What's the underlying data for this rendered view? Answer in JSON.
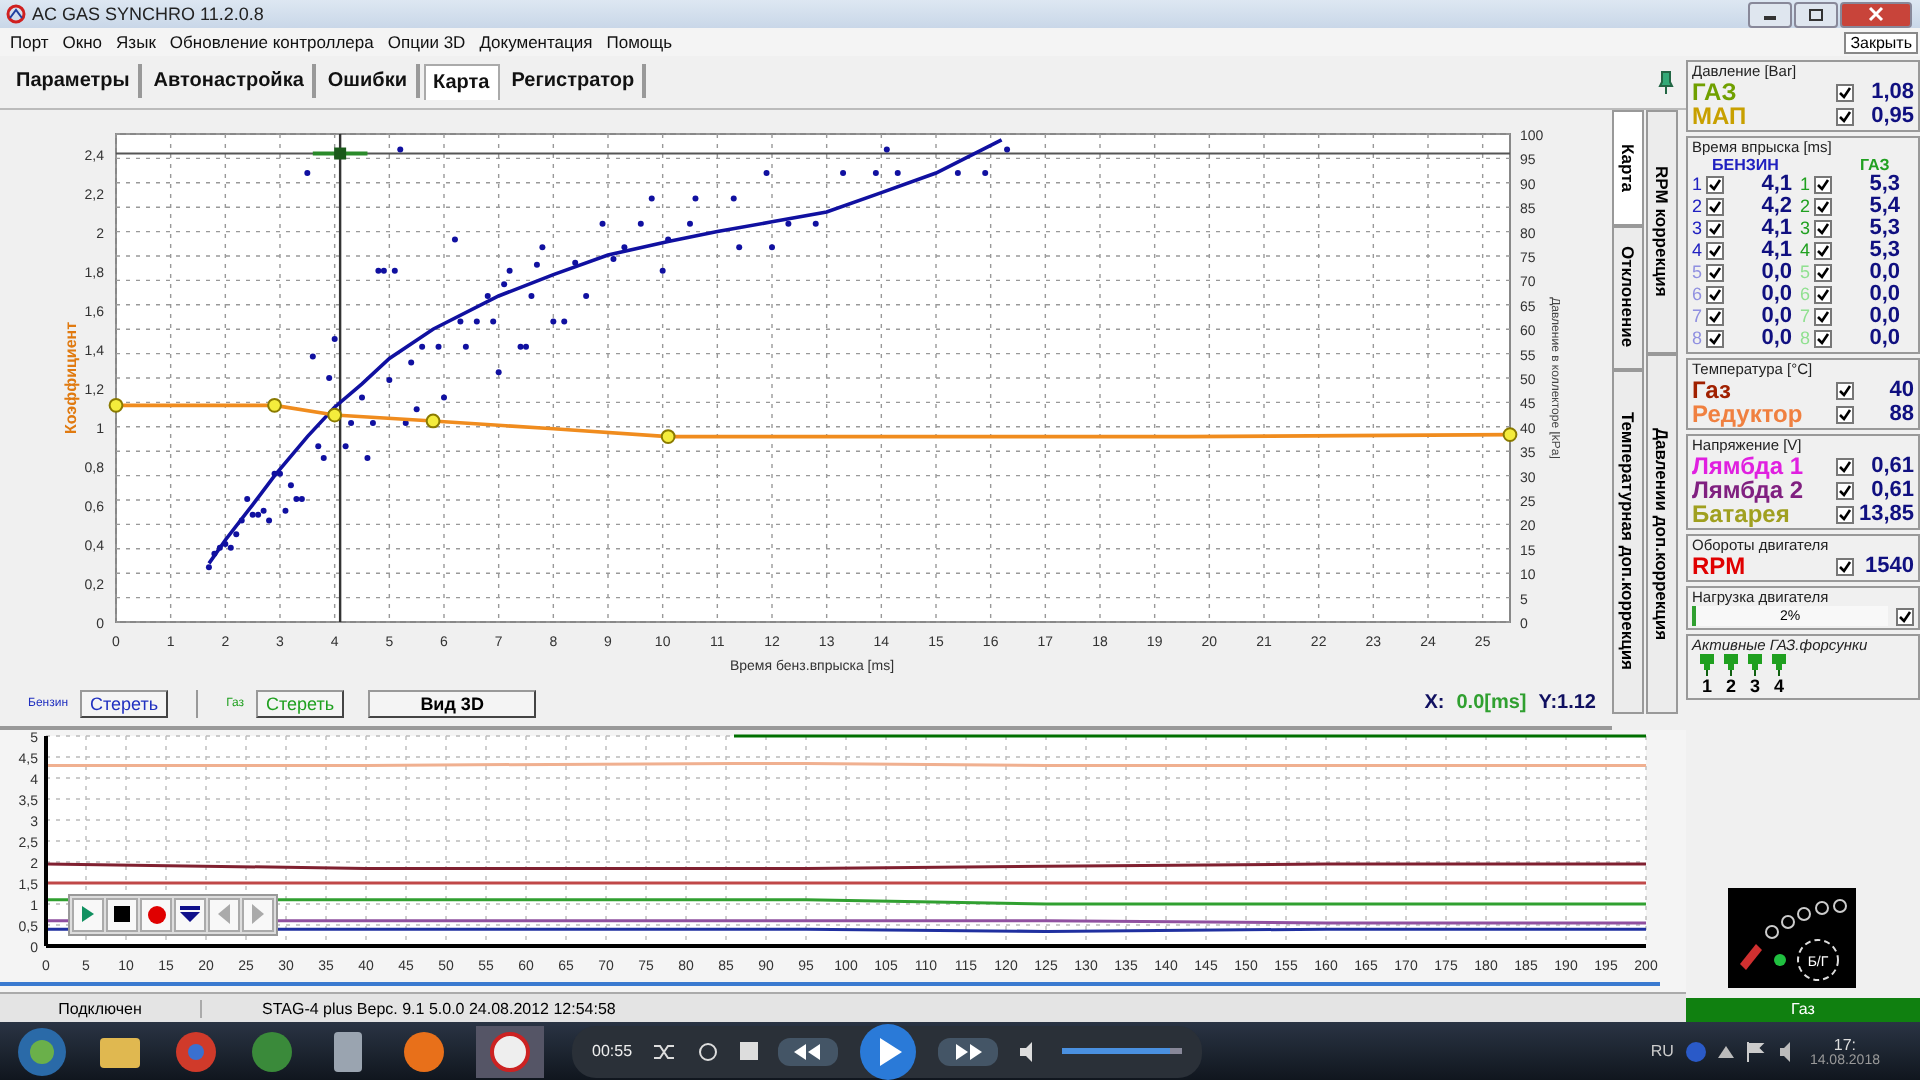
{
  "window": {
    "title": "AC GAS SYNCHRO  11.2.0.8"
  },
  "menu": [
    "Порт",
    "Окно",
    "Язык",
    "Обновление контроллера",
    "Опции 3D",
    "Документация",
    "Помощь"
  ],
  "tooltip": "Закрыть",
  "tabs": [
    {
      "label": "Параметры",
      "selected": false
    },
    {
      "label": "Автонастройка",
      "selected": false
    },
    {
      "label": "Ошибки",
      "selected": false
    },
    {
      "label": "Карта",
      "selected": true
    },
    {
      "label": "Регистратор",
      "selected": false
    }
  ],
  "map_chart": {
    "chart_data": {
      "type": "scatter",
      "xlabel": "Время бенз.впрыска [ms]",
      "ylabel": "Коэффициент",
      "xlim": [
        0,
        25.5
      ],
      "ylim": [
        0,
        2.5
      ],
      "grid": true,
      "xticks": [
        0,
        1,
        2,
        3,
        4,
        5,
        6,
        7,
        8,
        9,
        10,
        11,
        12,
        13,
        14,
        15,
        16,
        17,
        18,
        19,
        20,
        21,
        22,
        23,
        24,
        25
      ],
      "yticks": [
        {
          "value": 0,
          "label": "0"
        },
        {
          "value": 0.2,
          "label": "0,2"
        },
        {
          "value": 0.4,
          "label": "0,4"
        },
        {
          "value": 0.6,
          "label": "0,6"
        },
        {
          "value": 0.8,
          "label": "0,8"
        },
        {
          "value": 1,
          "label": "1"
        },
        {
          "value": 1.2,
          "label": "1,2"
        },
        {
          "value": 1.4,
          "label": "1,4"
        },
        {
          "value": 1.6,
          "label": "1,6"
        },
        {
          "value": 1.8,
          "label": "1,8"
        },
        {
          "value": 2,
          "label": "2"
        },
        {
          "value": 2.2,
          "label": "2,2"
        },
        {
          "value": 2.4,
          "label": "2,4"
        }
      ],
      "series": [
        {
          "type": "scatter",
          "color": "#1010a0",
          "x": [
            1.7,
            1.8,
            1.9,
            2,
            2.1,
            2.2,
            2.3,
            2.4,
            2.5,
            2.6,
            2.7,
            2.8,
            2.9,
            3,
            3.1,
            3.2,
            3.3,
            3.4,
            3.5,
            3.6,
            3.7,
            3.8,
            3.9,
            4,
            4.2,
            4.3,
            4.5,
            4.6,
            4.7,
            4.8,
            4.9,
            5,
            5.1,
            5.2,
            5.3,
            5.4,
            5.5,
            5.6,
            5.9,
            6,
            6.2,
            6.3,
            6.4,
            6.6,
            6.8,
            6.9,
            7,
            7.1,
            7.2,
            7.4,
            7.5,
            7.6,
            7.7,
            7.8,
            8,
            8.2,
            8.4,
            8.6,
            8.9,
            9.1,
            9.3,
            9.6,
            9.8,
            10,
            10.1,
            10.5,
            10.6,
            11.3,
            11.4,
            11.9,
            12,
            12.3,
            12.8,
            13.3,
            13.9,
            14.1,
            14.3,
            15.4,
            15.9,
            16.3
          ],
          "values": [
            0.28,
            0.35,
            0.38,
            0.4,
            0.38,
            0.45,
            0.52,
            0.63,
            0.55,
            0.55,
            0.57,
            0.52,
            0.76,
            0.76,
            0.57,
            0.7,
            0.63,
            0.63,
            2.3,
            1.36,
            0.9,
            0.84,
            1.25,
            1.45,
            0.9,
            1.02,
            1.15,
            0.84,
            1.02,
            1.8,
            1.8,
            1.24,
            1.8,
            2.42,
            1.02,
            1.33,
            1.09,
            1.41,
            1.41,
            1.15,
            1.96,
            1.54,
            1.41,
            1.54,
            1.67,
            1.54,
            1.28,
            1.73,
            1.8,
            1.41,
            1.41,
            1.67,
            1.83,
            1.92,
            1.54,
            1.54,
            1.84,
            1.67,
            2.04,
            1.86,
            1.92,
            2.04,
            2.17,
            1.8,
            1.96,
            2.04,
            2.17,
            2.17,
            1.92,
            2.3,
            1.92,
            2.04,
            2.04,
            2.3,
            2.3,
            2.42,
            2.3,
            2.3,
            2.3,
            2.42
          ]
        },
        {
          "type": "line",
          "color": "#1010a0",
          "x": [
            1.7,
            2,
            2.5,
            2.9,
            3.5,
            4,
            4.5,
            5,
            5.8,
            7,
            8,
            9,
            10.1,
            11,
            12,
            13,
            14,
            15,
            16.2
          ],
          "values": [
            0.3,
            0.42,
            0.6,
            0.75,
            0.95,
            1.1,
            1.22,
            1.35,
            1.5,
            1.67,
            1.78,
            1.88,
            1.95,
            2.0,
            2.05,
            2.1,
            2.2,
            2.3,
            2.47
          ]
        },
        {
          "type": "line",
          "color": "#f08c1e",
          "x": [
            0,
            2.9,
            4,
            5.8,
            8,
            10.1,
            19.6,
            25.5
          ],
          "values": [
            1.11,
            1.11,
            1.06,
            1.03,
            0.99,
            0.95,
            0.95,
            0.96
          ]
        },
        {
          "type": "scatter",
          "color": "#f4ec3c",
          "x": [
            0,
            2.9,
            4,
            5.8,
            10.1,
            25.5
          ],
          "values": [
            1.11,
            1.11,
            1.06,
            1.03,
            0.95,
            0.96
          ]
        }
      ],
      "ref_lines": [
        {
          "axis": "y",
          "value": 2.4
        },
        {
          "axis": "x",
          "value": 4.1
        }
      ]
    },
    "right_axis": {
      "label": "Давление в коллекторе [kPa]",
      "ticks": [
        "100",
        "95",
        "90",
        "85",
        "80",
        "75",
        "70",
        "65",
        "60",
        "55",
        "50",
        "45",
        "40",
        "35",
        "30",
        "25",
        "20",
        "15",
        "10",
        "5",
        "0"
      ]
    },
    "side_tabs_inner": [
      {
        "label": "Карта",
        "selected": true
      },
      {
        "label": "Отклонение",
        "selected": false
      },
      {
        "label": "Температурная доп.коррекция",
        "selected": false
      }
    ],
    "side_tabs_outer": [
      {
        "label": "RPM коррекция",
        "selected": false
      },
      {
        "label": "Давлении доп.коррекция",
        "selected": false
      }
    ]
  },
  "map_controls": {
    "petrol_label": "Бензин",
    "petrol_clear": "Стереть",
    "gas_label": "Газ",
    "gas_clear": "Стереть",
    "view_3d": "Вид 3D",
    "x_label": "X:",
    "x_value": "0.0[ms]",
    "y_value": "Y:1.12"
  },
  "recorder_chart": {
    "chart_data": {
      "type": "line",
      "x": [
        0,
        40,
        86,
        95,
        125,
        160,
        200
      ],
      "xlim": [
        0,
        200
      ],
      "ylim": [
        0,
        5
      ],
      "grid": true,
      "xticks": [
        0,
        5,
        10,
        15,
        20,
        25,
        30,
        35,
        40,
        45,
        50,
        55,
        60,
        65,
        70,
        75,
        80,
        85,
        90,
        95,
        100,
        105,
        110,
        115,
        120,
        125,
        130,
        135,
        140,
        145,
        150,
        155,
        160,
        165,
        170,
        175,
        180,
        185,
        190,
        195,
        200
      ],
      "yticks": [
        {
          "value": 0,
          "label": "0"
        },
        {
          "value": 0.5,
          "label": "0,5"
        },
        {
          "value": 1,
          "label": "1"
        },
        {
          "value": 1.5,
          "label": "1,5"
        },
        {
          "value": 2,
          "label": "2"
        },
        {
          "value": 2.5,
          "label": "2,5"
        },
        {
          "value": 3,
          "label": "3"
        },
        {
          "value": 3.5,
          "label": "3,5"
        },
        {
          "value": 4,
          "label": "4"
        },
        {
          "value": 4.5,
          "label": "4,5"
        },
        {
          "value": 5,
          "label": "5"
        }
      ],
      "series": [
        {
          "color": "#f0b090",
          "values": [
            4.3,
            4.3,
            4.35,
            4.35,
            4.3,
            4.3,
            4.3
          ]
        },
        {
          "color": "#802030",
          "values": [
            1.95,
            1.85,
            1.85,
            1.85,
            1.9,
            1.95,
            1.95
          ]
        },
        {
          "color": "#c04848",
          "values": [
            1.5,
            1.5,
            1.5,
            1.5,
            1.5,
            1.5,
            1.5
          ]
        },
        {
          "color": "#30a030",
          "values": [
            1.1,
            1.1,
            1.1,
            1.1,
            1.0,
            1.0,
            1.0
          ]
        },
        {
          "color": "#9050a0",
          "values": [
            0.6,
            0.6,
            0.6,
            0.6,
            0.6,
            0.55,
            0.55
          ]
        },
        {
          "color": "#2030a0",
          "values": [
            0.4,
            0.4,
            0.4,
            0.4,
            0.35,
            0.4,
            0.4
          ]
        },
        {
          "color": "#007000",
          "values": [
            null,
            null,
            5,
            5,
            5,
            5,
            5
          ]
        }
      ]
    }
  },
  "status_bar": {
    "connection": "Подключен",
    "info": "STAG-4 plus  Верс. 9.1  5.0.0   24.08.2012 12:54:58"
  },
  "pressure": {
    "title": "Давление [Bar]",
    "rows": [
      {
        "label": "ГАЗ",
        "color": "#70a000",
        "checked": true,
        "value": "1,08"
      },
      {
        "label": "МАП",
        "color": "#c8a000",
        "checked": true,
        "value": "0,95"
      }
    ]
  },
  "injection": {
    "title": "Время впрыска [ms]",
    "petrol_header": "БЕНЗИН",
    "gas_header": "ГАЗ",
    "rows": [
      {
        "petrol_label": "1",
        "petrol_checked": true,
        "petrol_value": "4,1",
        "gas_label": "1",
        "gas_checked": true,
        "gas_value": "5,3",
        "active": true
      },
      {
        "petrol_label": "2",
        "petrol_checked": true,
        "petrol_value": "4,2",
        "gas_label": "2",
        "gas_checked": true,
        "gas_value": "5,4",
        "active": true
      },
      {
        "petrol_label": "3",
        "petrol_checked": true,
        "petrol_value": "4,1",
        "gas_label": "3",
        "gas_checked": true,
        "gas_value": "5,3",
        "active": true
      },
      {
        "petrol_label": "4",
        "petrol_checked": true,
        "petrol_value": "4,1",
        "gas_label": "4",
        "gas_checked": true,
        "gas_value": "5,3",
        "active": true
      },
      {
        "petrol_label": "5",
        "petrol_checked": true,
        "petrol_value": "0,0",
        "gas_label": "5",
        "gas_checked": true,
        "gas_value": "0,0",
        "active": false
      },
      {
        "petrol_label": "6",
        "petrol_checked": true,
        "petrol_value": "0,0",
        "gas_label": "6",
        "gas_checked": true,
        "gas_value": "0,0",
        "active": false
      },
      {
        "petrol_label": "7",
        "petrol_checked": true,
        "petrol_value": "0,0",
        "gas_label": "7",
        "gas_checked": true,
        "gas_value": "0,0",
        "active": false
      },
      {
        "petrol_label": "8",
        "petrol_checked": true,
        "petrol_value": "0,0",
        "gas_label": "8",
        "gas_checked": true,
        "gas_value": "0,0",
        "active": false
      }
    ]
  },
  "temperature": {
    "title": "Температура  [°C]",
    "rows": [
      {
        "label": "Газ",
        "color": "#a02000",
        "checked": true,
        "value": "40"
      },
      {
        "label": "Редуктор",
        "color": "#f08040",
        "checked": true,
        "value": "88"
      }
    ]
  },
  "voltage": {
    "title": "Напряжение [V]",
    "rows": [
      {
        "label": "Лямбда 1",
        "color": "#e020e0",
        "checked": true,
        "value": "0,61"
      },
      {
        "label": "Лямбда 2",
        "color": "#802080",
        "checked": true,
        "value": "0,61"
      },
      {
        "label": "Батарея",
        "color": "#a0a020",
        "checked": true,
        "value": "13,85"
      }
    ]
  },
  "rpm": {
    "title": "Обороты двигателя",
    "rows": [
      {
        "label": "RPM",
        "color": "#e00000",
        "checked": true,
        "value": "1540"
      }
    ]
  },
  "load": {
    "title": "Нагрузка двигателя",
    "level": 0.02,
    "reading": "2%",
    "checked": true
  },
  "injectors": {
    "title": "Активные ГАЗ.форсунки",
    "items": [
      {
        "label": "1",
        "on": true
      },
      {
        "label": "2",
        "on": true
      },
      {
        "label": "3",
        "on": true
      },
      {
        "label": "4",
        "on": true
      }
    ]
  },
  "fuel_indicator": {
    "gauge_label": "Б/Г",
    "mode": "Газ"
  },
  "taskbar": {
    "player_time": "00:55",
    "volume": {
      "level": 0.9
    },
    "language": "RU",
    "clock": "17:",
    "date": "14.08.2018"
  }
}
